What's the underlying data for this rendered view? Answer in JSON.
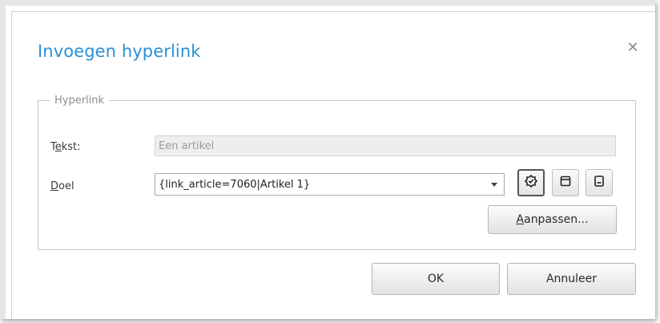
{
  "dialog": {
    "title": "Invoegen hyperlink",
    "close_icon": "close-icon",
    "accent_color": "#2b8fd6"
  },
  "group": {
    "legend": "Hyperlink"
  },
  "tekst": {
    "label_underlined": "e",
    "label_pre": "T",
    "label_post": "kst:",
    "value": "Een artikel"
  },
  "doel": {
    "label_underlined": "D",
    "label_post": "oel",
    "value": "{link_article=7060|Artikel 1}"
  },
  "icon_buttons": [
    {
      "icon": "link-icon"
    },
    {
      "icon": "document-icon"
    },
    {
      "icon": "page-icon"
    }
  ],
  "buttons": {
    "aanpassen_underlined": "A",
    "aanpassen_post": "anpassen...",
    "ok": "OK",
    "annuleer": "Annuleer"
  }
}
